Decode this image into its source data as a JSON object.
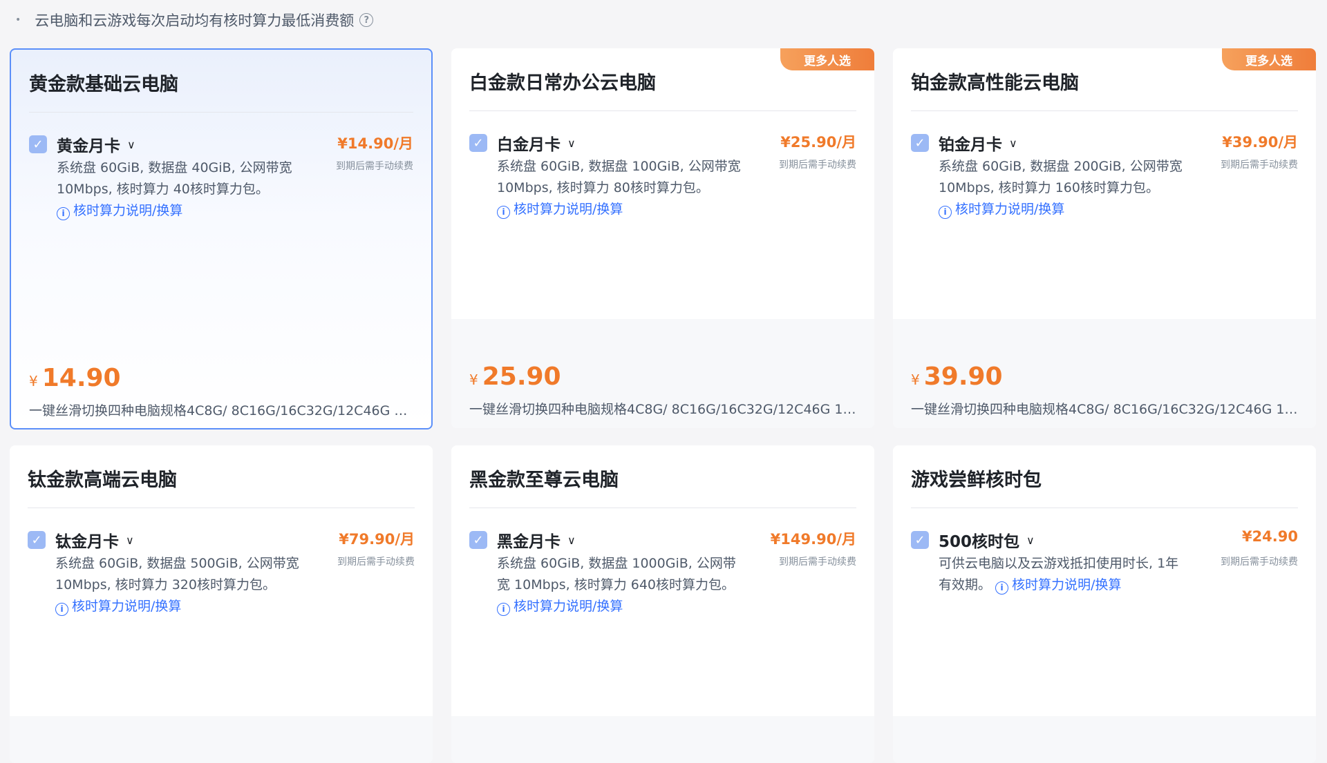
{
  "notice": {
    "text": "云电脑和云游戏每次启动均有核时算力最低消费额",
    "help_icon": "question-circle-icon"
  },
  "badge_label": "更多人选",
  "renew_note": "到期后需手动续费",
  "currency": "¥",
  "link_label": "核时算力说明/换算",
  "cards": [
    {
      "title": "黄金款基础云电脑",
      "plan": "黄金月卡",
      "price_tag": "¥14.90/月",
      "desc": "系统盘 60GiB, 数据盘 40GiB, 公网带宽 10Mbps, 核时算力 40核时算力包。",
      "amount": "14.90",
      "spec": "一键丝滑切换四种电脑规格4C8G/ 8C16G/16C32G/12C46G …",
      "selected": true,
      "badge": false
    },
    {
      "title": "白金款日常办公云电脑",
      "plan": "白金月卡",
      "price_tag": "¥25.90/月",
      "desc": "系统盘 60GiB, 数据盘 100GiB, 公网带宽 10Mbps, 核时算力 80核时算力包。",
      "amount": "25.90",
      "spec": "一键丝滑切换四种电脑规格4C8G/ 8C16G/16C32G/12C46G 1…",
      "selected": false,
      "badge": true
    },
    {
      "title": "铂金款高性能云电脑",
      "plan": "铂金月卡",
      "price_tag": "¥39.90/月",
      "desc": "系统盘 60GiB, 数据盘 200GiB, 公网带宽 10Mbps, 核时算力 160核时算力包。",
      "amount": "39.90",
      "spec": "一键丝滑切换四种电脑规格4C8G/ 8C16G/16C32G/12C46G 1…",
      "selected": false,
      "badge": true
    },
    {
      "title": "钛金款高端云电脑",
      "plan": "钛金月卡",
      "price_tag": "¥79.90/月",
      "desc": "系统盘 60GiB, 数据盘 500GiB, 公网带宽 10Mbps, 核时算力 320核时算力包。",
      "selected": false,
      "badge": false
    },
    {
      "title": "黑金款至尊云电脑",
      "plan": "黑金月卡",
      "price_tag": "¥149.90/月",
      "desc": "系统盘 60GiB, 数据盘 1000GiB, 公网带宽 10Mbps, 核时算力 640核时算力包。",
      "selected": false,
      "badge": false
    },
    {
      "title": "游戏尝鲜核时包",
      "plan": "500核时包",
      "price_tag": "¥24.90",
      "desc": "可供云电脑以及云游戏抵扣使用时长, 1年有效期。",
      "selected": false,
      "badge": false
    }
  ]
}
